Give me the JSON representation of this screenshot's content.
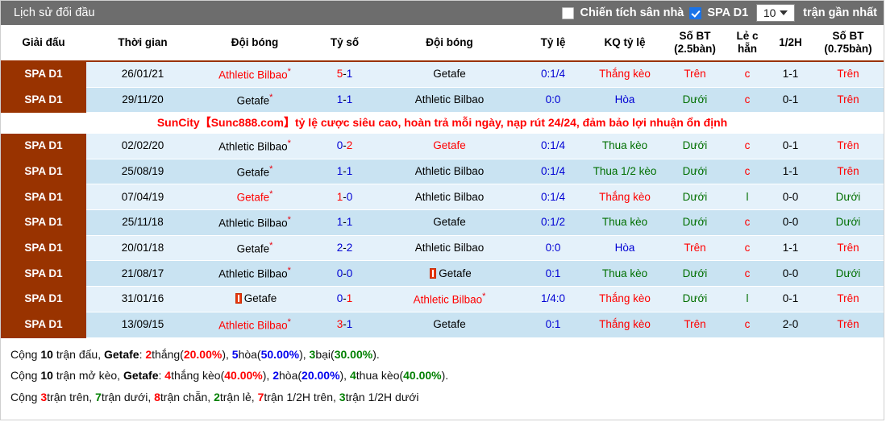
{
  "header": {
    "title": "Lịch sử đối đầu",
    "home_filter_label": "Chiến tích sân nhà",
    "home_filter_checked": false,
    "league_filter_label": "SPA D1",
    "league_filter_checked": true,
    "count_value": "10",
    "count_suffix": "trận gần nhất"
  },
  "columns": [
    "Giải đấu",
    "Thời gian",
    "Đội bóng",
    "Tỷ số",
    "Đội bóng",
    "Tỷ lệ",
    "KQ tỷ lệ",
    "Số BT (2.5bàn)",
    "Lẻ c hẵn",
    "1/2H",
    "Số BT (0.75bàn)"
  ],
  "ad": "SunCity【Sunc888.com】tỷ lệ cược siêu cao, hoàn trả mỗi ngày, nạp rút 24/24, đảm bảo lợi nhuận ổn định",
  "ad_after_row": 2,
  "rows": [
    {
      "league": "SPA D1",
      "date": "26/01/21",
      "home": "Athletic Bilbao",
      "home_star": true,
      "home_color": "red",
      "home_card": false,
      "score_a": "5",
      "score_b": "1",
      "score_a_color": "red",
      "score_b_color": "blue",
      "away": "Getafe",
      "away_star": false,
      "away_color": "black",
      "away_card": false,
      "odds": "0:1/4",
      "result": "Thắng kèo",
      "result_color": "red",
      "ou25": "Trên",
      "ou25_color": "red",
      "oddeven": "c",
      "oddeven_color": "red",
      "half": "1-1",
      "ou075": "Trên",
      "ou075_color": "red"
    },
    {
      "league": "SPA D1",
      "date": "29/11/20",
      "home": "Getafe",
      "home_star": true,
      "home_color": "black",
      "home_card": false,
      "score_a": "1",
      "score_b": "1",
      "score_a_color": "blue",
      "score_b_color": "blue",
      "away": "Athletic Bilbao",
      "away_star": false,
      "away_color": "black",
      "away_card": false,
      "odds": "0:0",
      "result": "Hòa",
      "result_color": "blue",
      "ou25": "Dưới",
      "ou25_color": "green",
      "oddeven": "c",
      "oddeven_color": "red",
      "half": "0-1",
      "ou075": "Trên",
      "ou075_color": "red"
    },
    {
      "league": "SPA D1",
      "date": "02/02/20",
      "home": "Athletic Bilbao",
      "home_star": true,
      "home_color": "black",
      "home_card": false,
      "score_a": "0",
      "score_b": "2",
      "score_a_color": "blue",
      "score_b_color": "red",
      "away": "Getafe",
      "away_star": false,
      "away_color": "red",
      "away_card": false,
      "odds": "0:1/4",
      "result": "Thua kèo",
      "result_color": "green",
      "ou25": "Dưới",
      "ou25_color": "green",
      "oddeven": "c",
      "oddeven_color": "red",
      "half": "0-1",
      "ou075": "Trên",
      "ou075_color": "red"
    },
    {
      "league": "SPA D1",
      "date": "25/08/19",
      "home": "Getafe",
      "home_star": true,
      "home_color": "black",
      "home_card": false,
      "score_a": "1",
      "score_b": "1",
      "score_a_color": "blue",
      "score_b_color": "blue",
      "away": "Athletic Bilbao",
      "away_star": false,
      "away_color": "black",
      "away_card": false,
      "odds": "0:1/4",
      "result": "Thua 1/2 kèo",
      "result_color": "green",
      "ou25": "Dưới",
      "ou25_color": "green",
      "oddeven": "c",
      "oddeven_color": "red",
      "half": "1-1",
      "ou075": "Trên",
      "ou075_color": "red"
    },
    {
      "league": "SPA D1",
      "date": "07/04/19",
      "home": "Getafe",
      "home_star": true,
      "home_color": "red",
      "home_card": false,
      "score_a": "1",
      "score_b": "0",
      "score_a_color": "red",
      "score_b_color": "blue",
      "away": "Athletic Bilbao",
      "away_star": false,
      "away_color": "black",
      "away_card": false,
      "odds": "0:1/4",
      "result": "Thắng kèo",
      "result_color": "red",
      "ou25": "Dưới",
      "ou25_color": "green",
      "oddeven": "l",
      "oddeven_color": "green",
      "half": "0-0",
      "ou075": "Dưới",
      "ou075_color": "green"
    },
    {
      "league": "SPA D1",
      "date": "25/11/18",
      "home": "Athletic Bilbao",
      "home_star": true,
      "home_color": "black",
      "home_card": false,
      "score_a": "1",
      "score_b": "1",
      "score_a_color": "blue",
      "score_b_color": "blue",
      "away": "Getafe",
      "away_star": false,
      "away_color": "black",
      "away_card": false,
      "odds": "0:1/2",
      "result": "Thua kèo",
      "result_color": "green",
      "ou25": "Dưới",
      "ou25_color": "green",
      "oddeven": "c",
      "oddeven_color": "red",
      "half": "0-0",
      "ou075": "Dưới",
      "ou075_color": "green"
    },
    {
      "league": "SPA D1",
      "date": "20/01/18",
      "home": "Getafe",
      "home_star": true,
      "home_color": "black",
      "home_card": false,
      "score_a": "2",
      "score_b": "2",
      "score_a_color": "blue",
      "score_b_color": "blue",
      "away": "Athletic Bilbao",
      "away_star": false,
      "away_color": "black",
      "away_card": false,
      "odds": "0:0",
      "result": "Hòa",
      "result_color": "blue",
      "ou25": "Trên",
      "ou25_color": "red",
      "oddeven": "c",
      "oddeven_color": "red",
      "half": "1-1",
      "ou075": "Trên",
      "ou075_color": "red"
    },
    {
      "league": "SPA D1",
      "date": "21/08/17",
      "home": "Athletic Bilbao",
      "home_star": true,
      "home_color": "black",
      "home_card": false,
      "score_a": "0",
      "score_b": "0",
      "score_a_color": "blue",
      "score_b_color": "blue",
      "away": "Getafe",
      "away_star": false,
      "away_color": "black",
      "away_card": true,
      "odds": "0:1",
      "result": "Thua kèo",
      "result_color": "green",
      "ou25": "Dưới",
      "ou25_color": "green",
      "oddeven": "c",
      "oddeven_color": "red",
      "half": "0-0",
      "ou075": "Dưới",
      "ou075_color": "green"
    },
    {
      "league": "SPA D1",
      "date": "31/01/16",
      "home": "Getafe",
      "home_star": false,
      "home_color": "black",
      "home_card": true,
      "score_a": "0",
      "score_b": "1",
      "score_a_color": "blue",
      "score_b_color": "red",
      "away": "Athletic Bilbao",
      "away_star": true,
      "away_color": "red",
      "away_card": false,
      "odds": "1/4:0",
      "result": "Thắng kèo",
      "result_color": "red",
      "ou25": "Dưới",
      "ou25_color": "green",
      "oddeven": "l",
      "oddeven_color": "green",
      "half": "0-1",
      "ou075": "Trên",
      "ou075_color": "red"
    },
    {
      "league": "SPA D1",
      "date": "13/09/15",
      "home": "Athletic Bilbao",
      "home_star": true,
      "home_color": "red",
      "home_card": false,
      "score_a": "3",
      "score_b": "1",
      "score_a_color": "red",
      "score_b_color": "blue",
      "away": "Getafe",
      "away_star": false,
      "away_color": "black",
      "away_card": false,
      "odds": "0:1",
      "result": "Thắng kèo",
      "result_color": "red",
      "ou25": "Trên",
      "ou25_color": "red",
      "oddeven": "c",
      "oddeven_color": "red",
      "half": "2-0",
      "ou075": "Trên",
      "ou075_color": "red"
    }
  ],
  "summary": {
    "line1": {
      "prefix": "Cộng ",
      "total": "10",
      "mid": " trận đấu, ",
      "team": "Getafe",
      "colon": ": ",
      "win_n": "2",
      "win_label": "thắng(",
      "win_pct": "20.00%",
      "win_close": "), ",
      "draw_n": "5",
      "draw_label": "hòa(",
      "draw_pct": "50.00%",
      "draw_close": "), ",
      "loss_n": "3",
      "loss_label": "bại(",
      "loss_pct": "30.00%",
      "loss_close": ")."
    },
    "line2": {
      "prefix": "Cộng ",
      "total": "10",
      "mid": " trận mở kèo, ",
      "team": "Getafe",
      "colon": ": ",
      "win_n": "4",
      "win_label": "thắng kèo(",
      "win_pct": "40.00%",
      "win_close": "), ",
      "draw_n": "2",
      "draw_label": "hòa(",
      "draw_pct": "20.00%",
      "draw_close": "), ",
      "loss_n": "4",
      "loss_label": "thua kèo(",
      "loss_pct": "40.00%",
      "loss_close": ")."
    },
    "line3": {
      "prefix": "Cộng ",
      "over_n": "3",
      "over_label": "trận trên, ",
      "under_n": "7",
      "under_label": "trận dưới, ",
      "even_n": "8",
      "even_label": "trận chẵn, ",
      "odd_n": "2",
      "odd_label": "trận lẻ, ",
      "h_over_n": "7",
      "h_over_label": "trận 1/2H trên, ",
      "h_under_n": "3",
      "h_under_label": "trận 1/2H dưới"
    }
  }
}
